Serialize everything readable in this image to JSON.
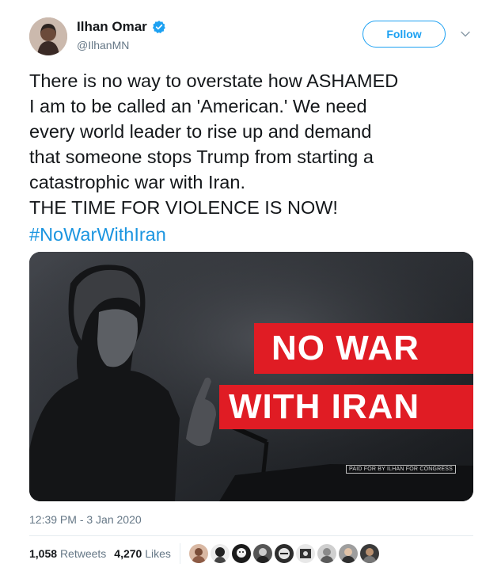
{
  "author": {
    "name": "Ilhan Omar",
    "handle": "@IlhanMN",
    "avatar_icon": "profile-photo-avatar",
    "verified_icon": "verified-badge-icon"
  },
  "follow_label": "Follow",
  "tweet": {
    "lines": [
      "There is no way to overstate how ASHAMED",
      "I am to be called an 'American.' We need",
      "every world leader to rise up and demand",
      "that someone stops Trump from starting a",
      "catastrophic war with Iran.",
      "THE TIME FOR VIOLENCE IS NOW!"
    ],
    "hashtag": "#NoWarWithIran"
  },
  "media": {
    "banner_line1": "NO WAR",
    "banner_line2": "WITH IRAN",
    "disclaimer": "PAID FOR BY ILHAN FOR CONGRESS"
  },
  "timestamp": "12:39 PM - 3 Jan 2020",
  "stats": {
    "retweets_count": "1,058",
    "retweets_label": "Retweets",
    "likes_count": "4,270",
    "likes_label": "Likes"
  },
  "colors": {
    "accent": "#1da1f2",
    "hashtag": "#1b95e0",
    "banner_red": "#e01c24",
    "muted": "#657786"
  }
}
